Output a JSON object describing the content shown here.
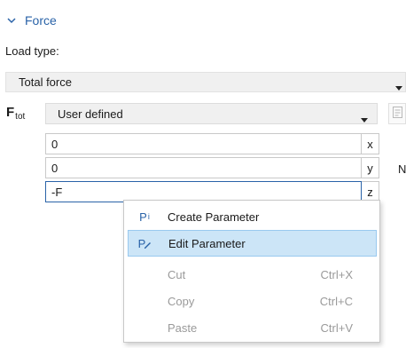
{
  "section": {
    "title": "Force",
    "collapse_icon": "chevron-down-icon"
  },
  "load_type": {
    "label": "Load type:",
    "value": "Total force"
  },
  "force": {
    "symbol": "F",
    "subscript": "tot",
    "selection": "User defined",
    "components": [
      {
        "value": "0",
        "axis": "x"
      },
      {
        "value": "0",
        "axis": "y"
      },
      {
        "value": "-F",
        "axis": "z"
      }
    ],
    "unit": "N"
  },
  "context_menu": {
    "items": [
      {
        "label": "Create Parameter",
        "icon": "create-parameter-icon",
        "icon_text": "P",
        "shortcut": "",
        "enabled": true,
        "highlighted": false
      },
      {
        "label": "Edit Parameter",
        "icon": "edit-parameter-icon",
        "icon_text": "P",
        "shortcut": "",
        "enabled": true,
        "highlighted": true
      },
      {
        "label": "Cut",
        "shortcut": "Ctrl+X",
        "enabled": false
      },
      {
        "label": "Copy",
        "shortcut": "Ctrl+C",
        "enabled": false
      },
      {
        "label": "Paste",
        "shortcut": "Ctrl+V",
        "enabled": false
      }
    ]
  },
  "colors": {
    "accent": "#2a63a8",
    "highlight": "#cce5f7",
    "disabled_text": "#9a9a9a"
  }
}
